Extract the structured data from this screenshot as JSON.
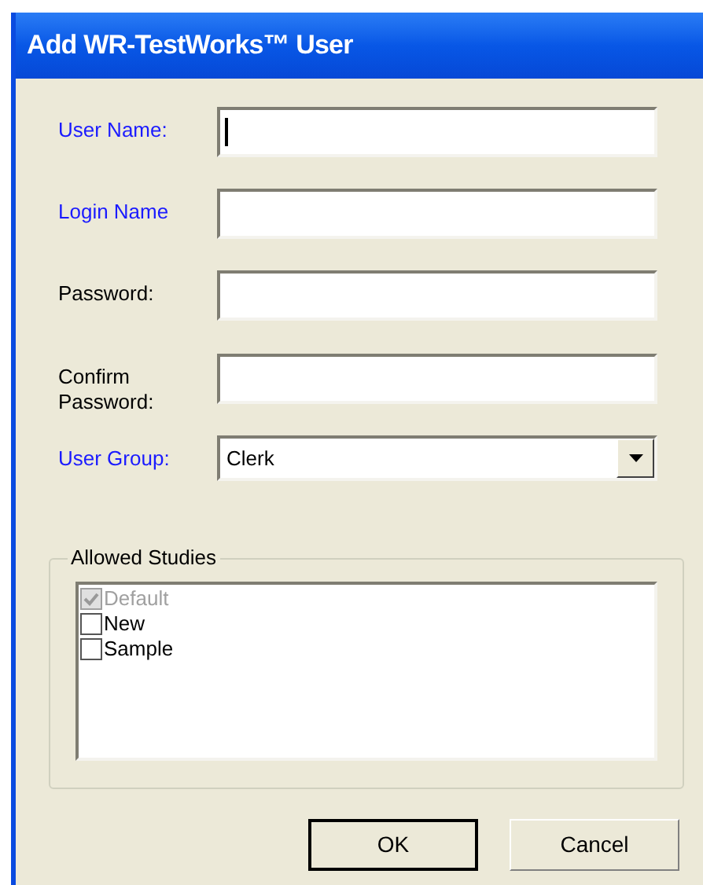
{
  "window": {
    "title": "Add WR-TestWorks™ User"
  },
  "fields": [
    {
      "label": "User Name:",
      "color": "#1a1aff",
      "kind": "text",
      "focused": true
    },
    {
      "label": "Login Name",
      "color": "#1a1aff",
      "kind": "text",
      "focused": false
    },
    {
      "label": "Password:",
      "color": "#000000",
      "kind": "text",
      "focused": false
    },
    {
      "label": "Confirm Password:",
      "color": "#000000",
      "kind": "text",
      "focused": false
    },
    {
      "label": "User Group:",
      "color": "#1a1aff",
      "kind": "dropdown",
      "value": "Clerk"
    }
  ],
  "allowed_studies": {
    "title": "Allowed Studies",
    "items": [
      {
        "label": "Default",
        "checked": true,
        "disabled": true
      },
      {
        "label": "New",
        "checked": false,
        "disabled": false
      },
      {
        "label": "Sample",
        "checked": false,
        "disabled": false
      }
    ]
  },
  "buttons": [
    {
      "label": "OK",
      "default": true
    },
    {
      "label": "Cancel",
      "default": false
    }
  ]
}
